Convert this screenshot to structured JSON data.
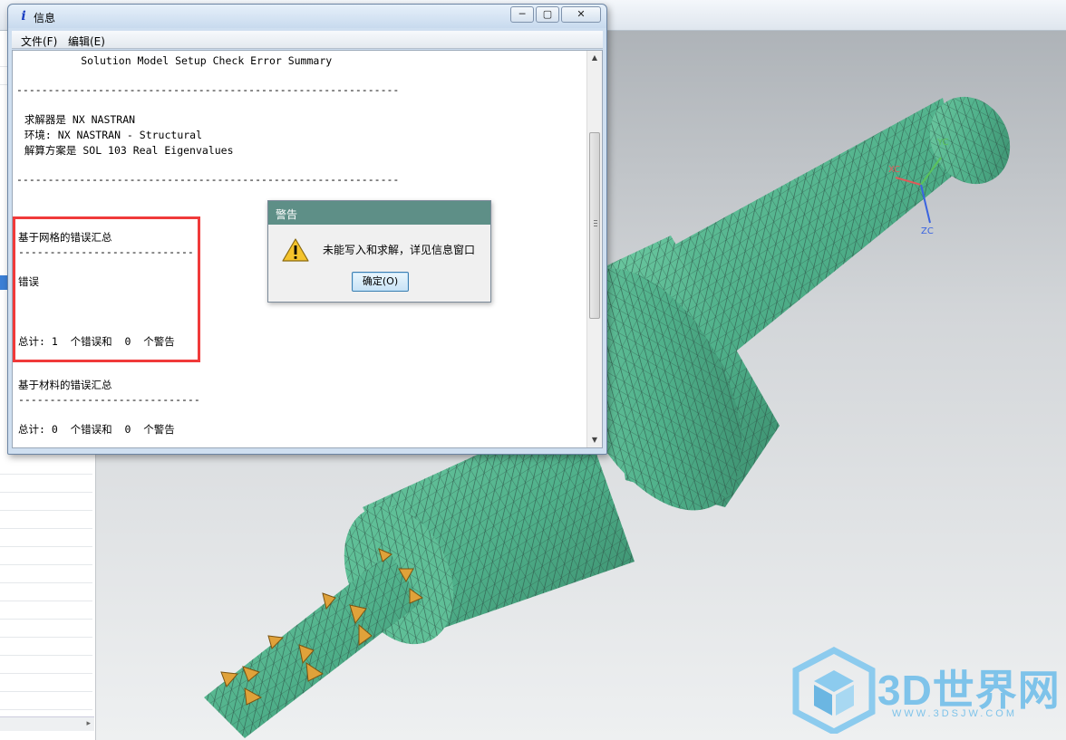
{
  "info_window": {
    "title": "信息",
    "controls": {
      "minimize": "─",
      "maximize": "▢",
      "close": "✕"
    },
    "menu": {
      "file": "文件(F)",
      "edit": "编辑(E)"
    },
    "content": {
      "header": "          Solution Model Setup Check Error Summary",
      "divider": "-------------------------------------------------------------",
      "solver": " 求解器是 NX NASTRAN",
      "environment": " 环境: NX NASTRAN - Structural",
      "solution": " 解算方案是 SOL 103 Real Eigenvalues",
      "divider2": "-------------------------------------------------------------",
      "mesh_section_title": "基于网格的错误汇总",
      "mesh_divider": "----------------------------",
      "mesh_error_label": "错误",
      "mesh_total": "总计: 1  个错误和  0  个警告",
      "material_section_title": "基于材料的错误汇总",
      "material_divider": "-----------------------------",
      "material_total": "总计: 0  个错误和  0  个警告"
    }
  },
  "warning_dialog": {
    "title": "警告",
    "icon": "warning-triangle-icon",
    "message": "未能写入和求解，详见信息窗口",
    "ok_label": "确定(O)"
  },
  "viewport": {
    "axes": {
      "x": "XC",
      "y": "YC",
      "z": "ZC"
    },
    "model": "meshed-tool-holder-with-end-mill"
  },
  "watermark": {
    "title": "3D世界网",
    "subtitle": "WWW.3DSJW.COM"
  },
  "colors": {
    "mesh_green": "#4fb08a",
    "highlight_red": "#f03a3a",
    "dialog_title": "#5e8f87",
    "watermark_blue": "#7ec3ea"
  }
}
